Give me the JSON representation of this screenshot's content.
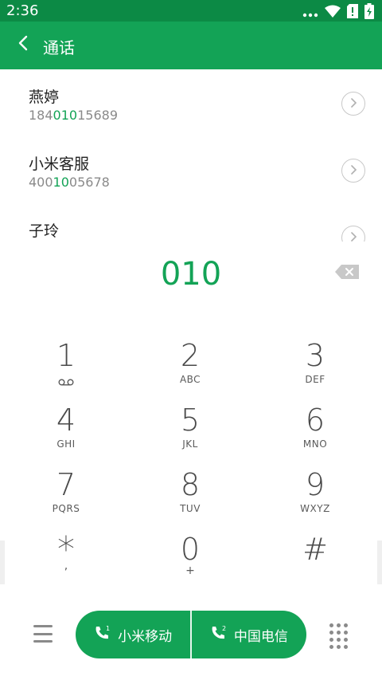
{
  "status_bar": {
    "time": "2:36"
  },
  "header": {
    "title": "通话"
  },
  "contacts": [
    {
      "name": "燕婷",
      "number_pre": "184",
      "number_match": "010",
      "number_post": "15689"
    },
    {
      "name": "小米客服",
      "number_pre": "400",
      "number_match": "10",
      "number_post": "05678"
    },
    {
      "name": "子玲",
      "number_pre": "",
      "number_match": "",
      "number_post": ""
    }
  ],
  "display": {
    "number": "010"
  },
  "keypad": [
    {
      "digit": "1",
      "letters": ""
    },
    {
      "digit": "2",
      "letters": "ABC"
    },
    {
      "digit": "3",
      "letters": "DEF"
    },
    {
      "digit": "4",
      "letters": "GHI"
    },
    {
      "digit": "5",
      "letters": "JKL"
    },
    {
      "digit": "6",
      "letters": "MNO"
    },
    {
      "digit": "7",
      "letters": "PQRS"
    },
    {
      "digit": "8",
      "letters": "TUV"
    },
    {
      "digit": "9",
      "letters": "WXYZ"
    },
    {
      "digit": "*",
      "letters": ","
    },
    {
      "digit": "0",
      "letters": "+"
    },
    {
      "digit": "#",
      "letters": ""
    }
  ],
  "call_buttons": {
    "sim1_label": "小米移动",
    "sim2_label": "中国电信",
    "sim1_badge": "1",
    "sim2_badge": "2"
  },
  "colors": {
    "accent": "#13a356",
    "status_bar": "#0c8a45"
  },
  "icons": {
    "status": [
      "signal-dots-icon",
      "wifi-icon",
      "sim-alert-icon",
      "battery-charging-icon"
    ],
    "header": "back-arrow-icon",
    "contact": "chevron-right-circle-icon",
    "display": "backspace-icon",
    "voicemail": "voicemail-icon",
    "call": "phone-icon",
    "menu": "menu-icon",
    "dialpad": "dialpad-icon"
  }
}
